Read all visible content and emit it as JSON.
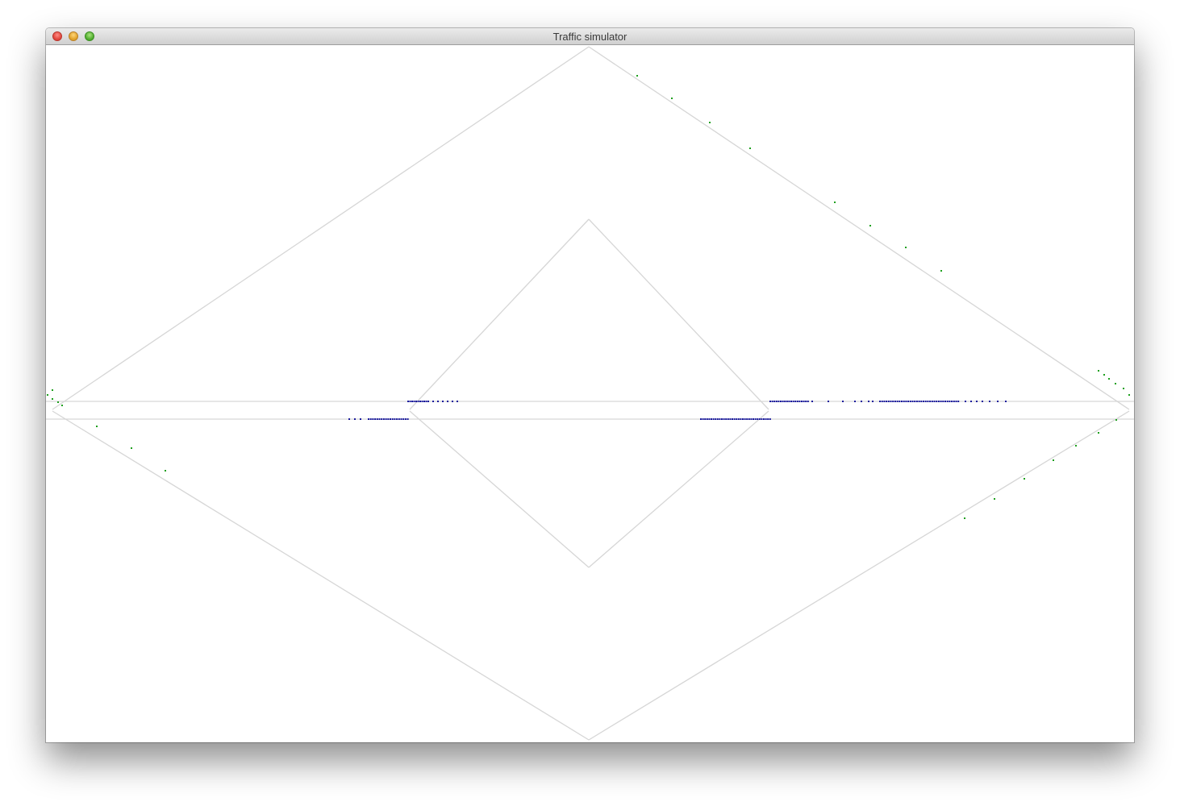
{
  "window": {
    "title": "Traffic simulator"
  },
  "colors": {
    "road": "#d6d6d6",
    "car_main": "#1a1a9c",
    "car_diag": "#1ea01e",
    "titlebar_text": "#3a3a3a"
  }
}
